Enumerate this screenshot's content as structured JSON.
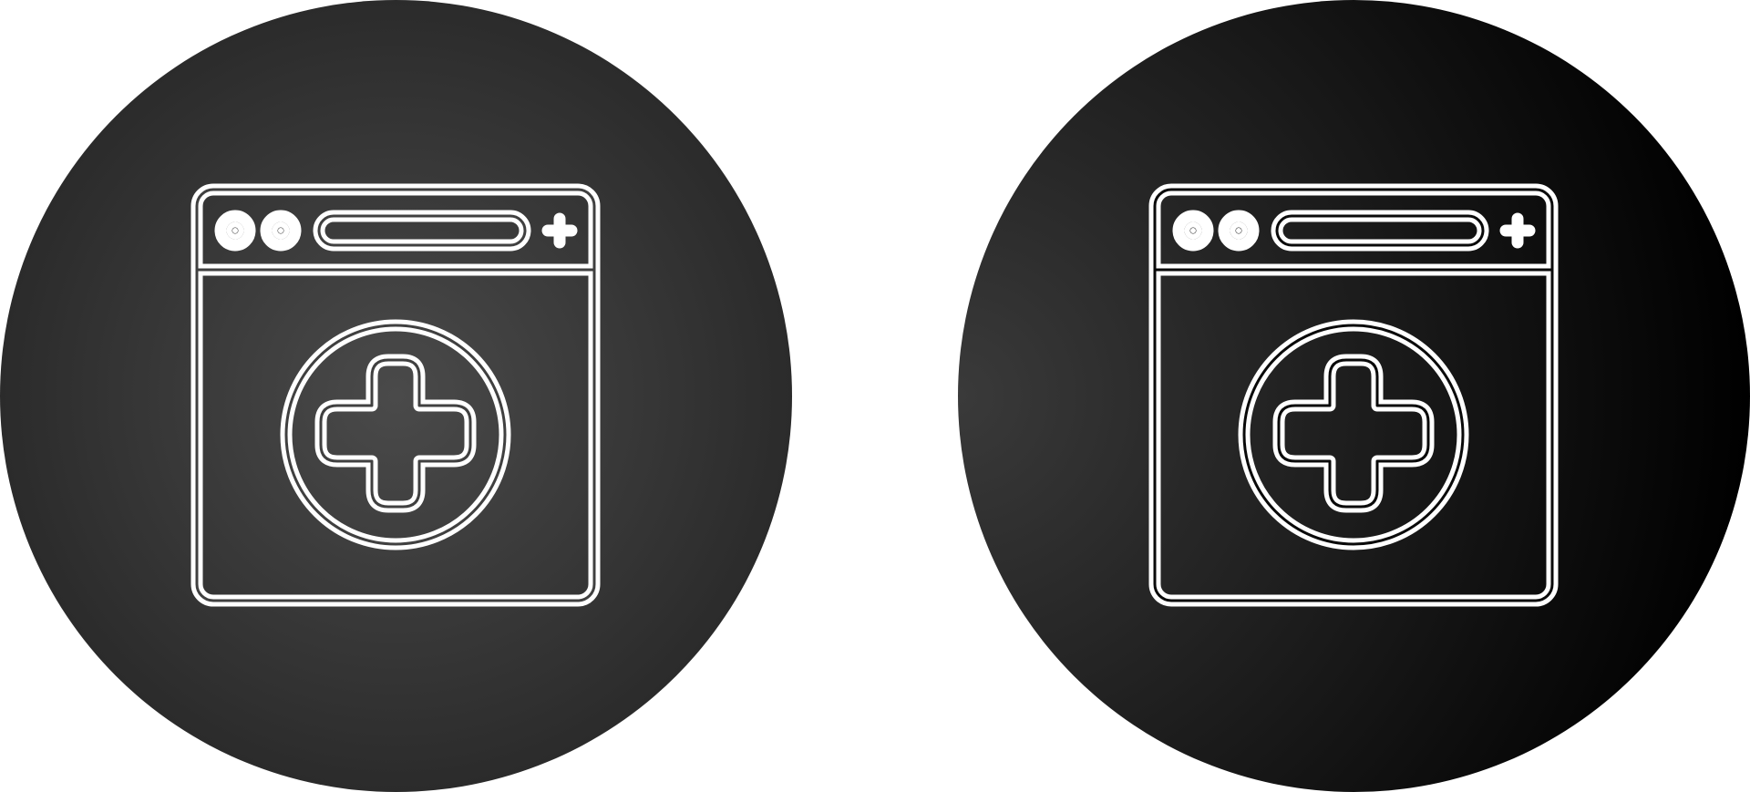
{
  "icons": [
    {
      "name": "medical-browser-icon",
      "style": "gradient-gray",
      "background_inner": "#4a4a4a",
      "background_outer": "#2b2b2b",
      "stroke": "#ffffff"
    },
    {
      "name": "medical-browser-icon",
      "style": "gradient-black",
      "background_inner": "#3a3a3a",
      "background_outer": "#000000",
      "stroke": "#ffffff"
    }
  ],
  "page_background": "#ffffff"
}
